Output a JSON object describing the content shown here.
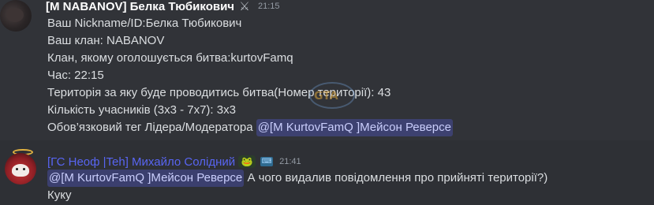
{
  "messages": [
    {
      "username": "[M NABANOV] Белка Тюбикович",
      "badge_icon": "crossed-swords-icon",
      "timestamp": "21:15",
      "lines": [
        "Ваш Nickname/ID:Белка Тюбикович",
        "Ваш клан: NABANOV",
        "Клан, якому оголошується битва:kurtovFamq",
        "Час: 22:15",
        "Територія за яку буде проводитись битва(Номер території): 43",
        "Кількість учасників (3x3 - 7x7): 3x3"
      ],
      "last_line_prefix": "Обов’язковий тег Лідера/Модератора ",
      "mention": "@[M KurtovFamQ ]Мейсон Реверсе",
      "watermark_text": "GTA"
    },
    {
      "username": "[ГС Неоф |Teh] Михайло Солідний",
      "badge_icon": "frog-icon",
      "badge2_icon": "keyboard-icon",
      "timestamp": "21:41",
      "mention": "@[M KurtovFamQ ]Мейсон Реверсе",
      "line1_suffix": " А чого видалив повідомлення про прийняті території?)",
      "line2": "Куку"
    }
  ],
  "colors": {
    "background": "#313338",
    "text": "#dbdee1",
    "mention_bg": "rgba(88,101,242,0.3)",
    "username2": "#5865f2",
    "timestamp": "#949ba4"
  }
}
